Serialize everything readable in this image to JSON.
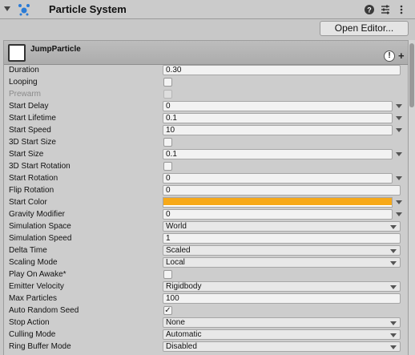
{
  "component": {
    "title": "Particle System",
    "open_editor_label": "Open Editor..."
  },
  "module": {
    "name": "JumpParticle",
    "warning_glyph": "!",
    "add_glyph": "+"
  },
  "colors": {
    "start_color": "#f7a919"
  },
  "fields": {
    "duration": {
      "label": "Duration",
      "value": "0.30"
    },
    "looping": {
      "label": "Looping",
      "checked": false
    },
    "prewarm": {
      "label": "Prewarm",
      "checked": false
    },
    "start_delay": {
      "label": "Start Delay",
      "value": "0"
    },
    "start_lifetime": {
      "label": "Start Lifetime",
      "value": "0.1"
    },
    "start_speed": {
      "label": "Start Speed",
      "value": "10"
    },
    "start_size_3d": {
      "label": "3D Start Size",
      "checked": false
    },
    "start_size": {
      "label": "Start Size",
      "value": "0.1"
    },
    "start_rotation_3d": {
      "label": "3D Start Rotation",
      "checked": false
    },
    "start_rotation": {
      "label": "Start Rotation",
      "value": "0"
    },
    "flip_rotation": {
      "label": "Flip Rotation",
      "value": "0"
    },
    "start_color": {
      "label": "Start Color"
    },
    "gravity_modifier": {
      "label": "Gravity Modifier",
      "value": "0"
    },
    "simulation_space": {
      "label": "Simulation Space",
      "value": "World"
    },
    "simulation_speed": {
      "label": "Simulation Speed",
      "value": "1"
    },
    "delta_time": {
      "label": "Delta Time",
      "value": "Scaled"
    },
    "scaling_mode": {
      "label": "Scaling Mode",
      "value": "Local"
    },
    "play_on_awake": {
      "label": "Play On Awake*",
      "checked": false
    },
    "emitter_velocity": {
      "label": "Emitter Velocity",
      "value": "Rigidbody"
    },
    "max_particles": {
      "label": "Max Particles",
      "value": "100"
    },
    "auto_random_seed": {
      "label": "Auto Random Seed",
      "checked": true,
      "check_glyph": "✓"
    },
    "stop_action": {
      "label": "Stop Action",
      "value": "None"
    },
    "culling_mode": {
      "label": "Culling Mode",
      "value": "Automatic"
    },
    "ring_buffer_mode": {
      "label": "Ring Buffer Mode",
      "value": "Disabled"
    }
  },
  "icons": {
    "component": "particle-system-icon",
    "help": "help-icon",
    "presets": "presets-icon",
    "menu": "kebab-menu-icon"
  }
}
